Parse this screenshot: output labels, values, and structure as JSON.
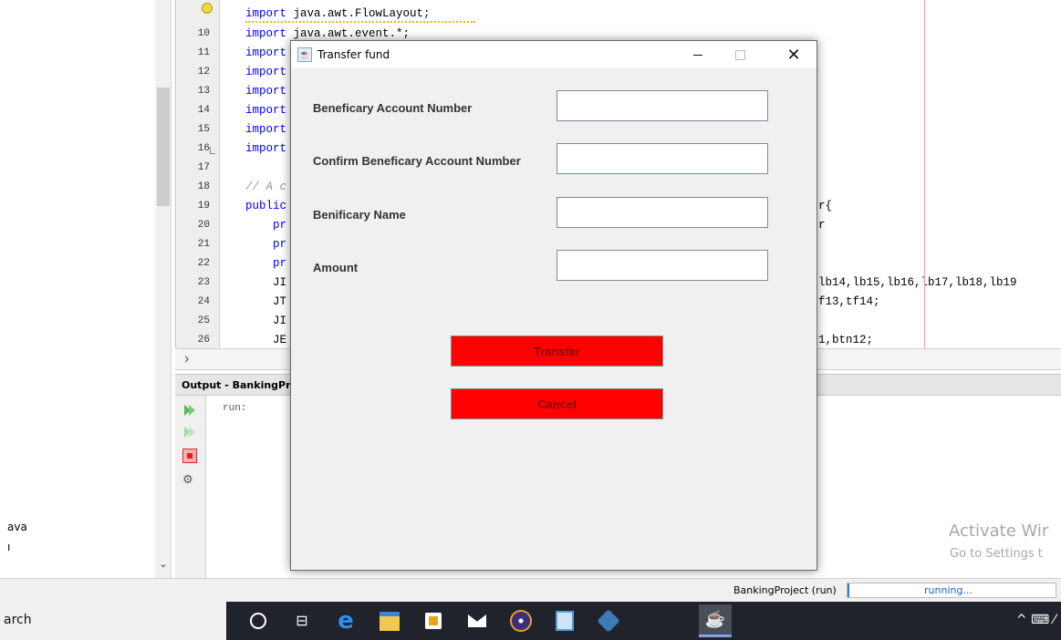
{
  "project_tree": {
    "items": [
      "ava",
      "ı"
    ]
  },
  "editor": {
    "line_numbers": [
      "",
      "10",
      "11",
      "12",
      "13",
      "14",
      "15",
      "16",
      "17",
      "18",
      "19",
      "20",
      "21",
      "22",
      "23",
      "24",
      "25",
      "26"
    ],
    "code_lines": [
      {
        "kw": "import",
        "rest": " java.awt.FlowLayout;"
      },
      {
        "kw": "import",
        "rest": " java.awt.event.*;"
      },
      {
        "kw": "import",
        "rest": ""
      },
      {
        "kw": "import",
        "rest": ""
      },
      {
        "kw": "import",
        "rest": ""
      },
      {
        "kw": "import",
        "rest": ""
      },
      {
        "kw": "import",
        "rest": ""
      },
      {
        "kw": "import",
        "rest": ""
      },
      {
        "kw": "",
        "rest": ""
      },
      {
        "kw": "",
        "rest": "// A c",
        "comment": true
      },
      {
        "kw": "public",
        "rest": ""
      },
      {
        "kw": "",
        "rest": "    pr"
      },
      {
        "kw": "",
        "rest": "    pr"
      },
      {
        "kw": "",
        "rest": "    pr"
      },
      {
        "kw": "",
        "rest": "    JI"
      },
      {
        "kw": "",
        "rest": "    JT"
      },
      {
        "kw": "",
        "rest": "    JI"
      },
      {
        "kw": "",
        "rest": "    JE"
      }
    ],
    "right_fragments": {
      "line19": "r{",
      "line20": "r",
      "line23": "lb14,lb15,lb16,lb17,lb18,lb19",
      "line24": "f13,tf14;",
      "line26": "1,btn12;"
    }
  },
  "output": {
    "title": "Output - BankingPr",
    "text": "run:"
  },
  "status_bar": {
    "project": "BankingProject (run)",
    "progress_text": "running..."
  },
  "watermark": {
    "line1": "Activate Wir",
    "line2": "Go to Settings t"
  },
  "taskbar": {
    "search_text": "arch",
    "taskview_glyph": "⊟",
    "edge_glyph": "e",
    "java_glyph": "☕",
    "tray_text": "^ ⌨ ⁄"
  },
  "dialog": {
    "title": "Transfer fund",
    "close_glyph": "✕",
    "fields": [
      {
        "label": "Beneficary Account Number",
        "value": ""
      },
      {
        "label": "Confirm Beneficary Account Number",
        "value": ""
      },
      {
        "label": "Benificary Name",
        "value": ""
      },
      {
        "label": "Amount",
        "value": ""
      }
    ],
    "transfer_label": "Transfer",
    "cancel_label": "Cancel"
  }
}
